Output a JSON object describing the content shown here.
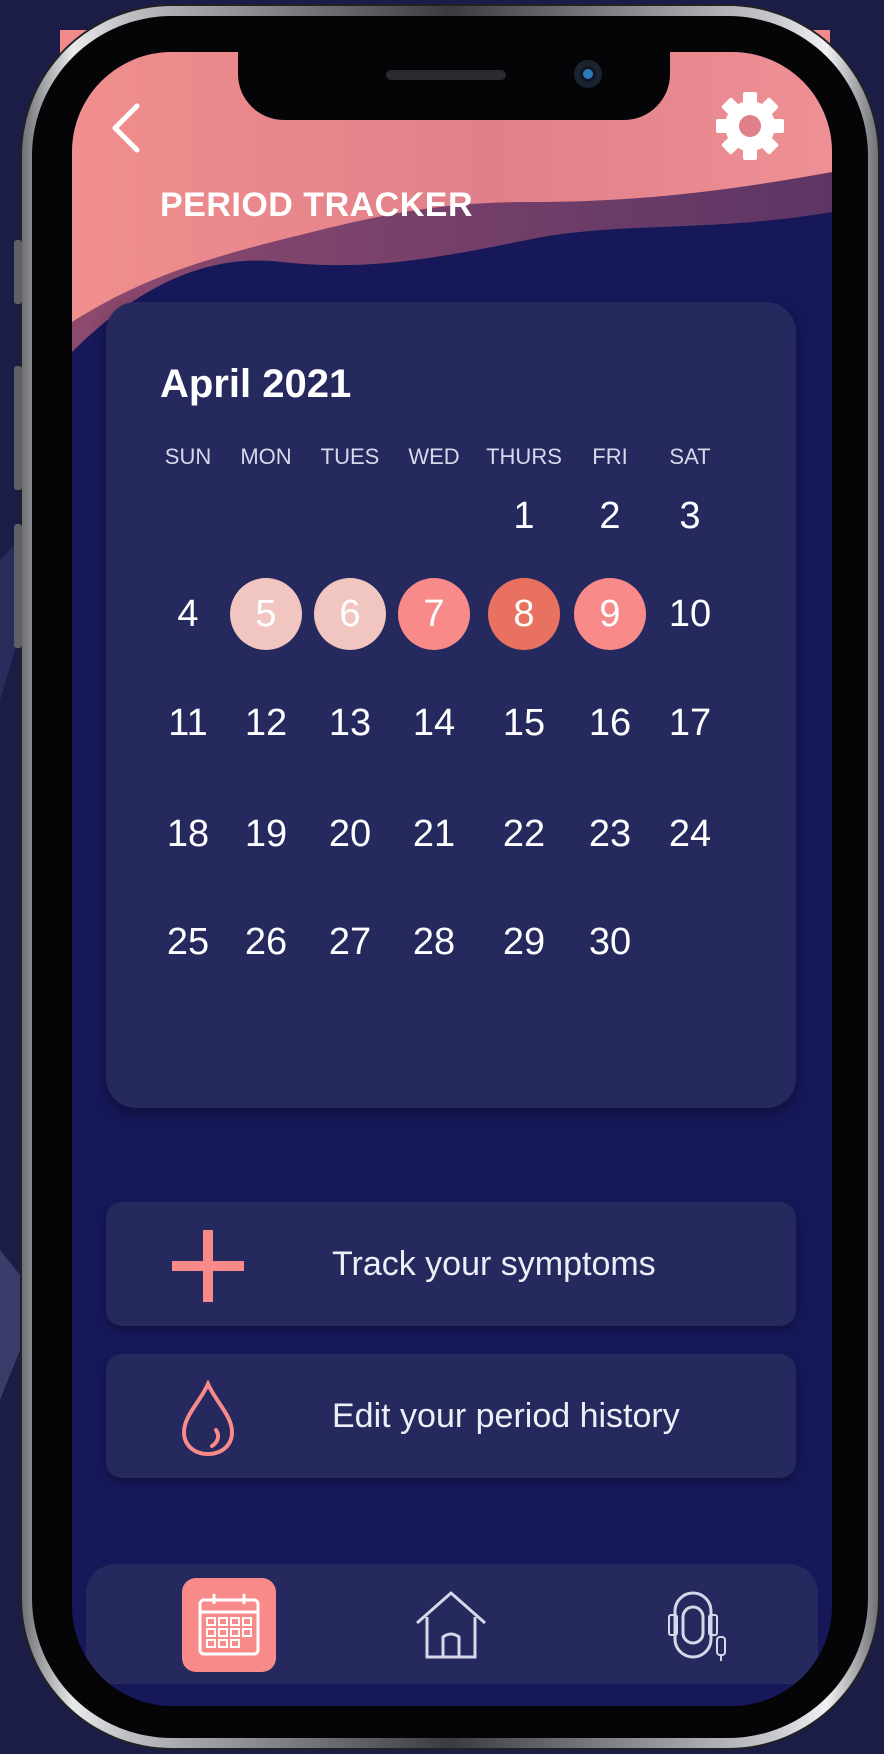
{
  "app": {
    "title": "PERIOD TRACKER"
  },
  "header": {
    "back_icon": "chevron-left-icon",
    "settings_icon": "gear-icon"
  },
  "calendar": {
    "month": "April 2021",
    "weekdays": [
      "SUN",
      "MON",
      "TUES",
      "WED",
      "THURS",
      "FRI",
      "SAT"
    ],
    "weeks": [
      [
        "",
        "",
        "",
        "",
        "1",
        "2",
        "3"
      ],
      [
        "4",
        "5",
        "6",
        "7",
        "8",
        "9",
        "10"
      ],
      [
        "11",
        "12",
        "13",
        "14",
        "15",
        "16",
        "17"
      ],
      [
        "18",
        "19",
        "20",
        "21",
        "22",
        "23",
        "24"
      ],
      [
        "25",
        "26",
        "27",
        "28",
        "29",
        "30",
        ""
      ]
    ],
    "highlighted": [
      {
        "day": "5",
        "color": "#f2c6c0"
      },
      {
        "day": "6",
        "color": "#f2c6c0"
      },
      {
        "day": "7",
        "color": "#f98a8a"
      },
      {
        "day": "8",
        "color": "#e8725f"
      },
      {
        "day": "9",
        "color": "#f98a8a"
      }
    ]
  },
  "actions": [
    {
      "label": "Track your symptoms",
      "icon": "plus-icon"
    },
    {
      "label": "Edit your period history",
      "icon": "drop-icon"
    }
  ],
  "tabbar": {
    "items": [
      {
        "icon": "calendar-icon",
        "active": true
      },
      {
        "icon": "home-icon",
        "active": false
      },
      {
        "icon": "pad-icon",
        "active": false
      }
    ]
  },
  "colors": {
    "accent": "#f98a8a",
    "background": "#16185a",
    "card": "#26295e",
    "header_pink": "#f0938f"
  }
}
